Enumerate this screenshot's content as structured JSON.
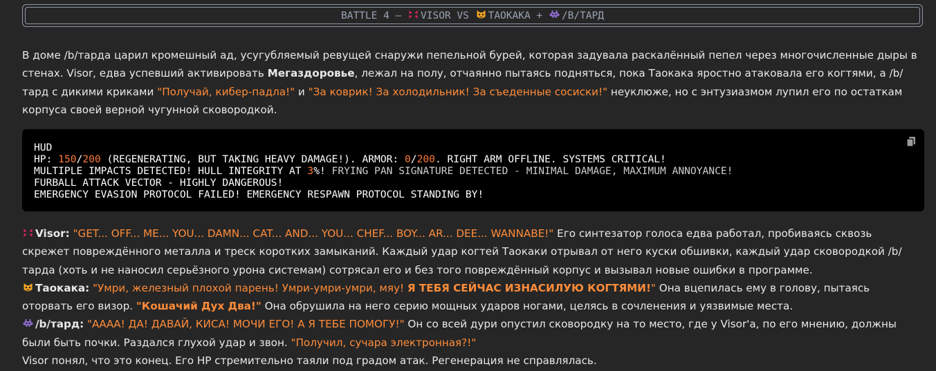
{
  "banner": {
    "prefix": "BATTLE 4 – ",
    "p1": "VISOR",
    "vs": " VS ",
    "p2": "TAOKAKA",
    "plus": " + ",
    "p3": "/B/ТАРД"
  },
  "intro": {
    "t1": "В доме /b/тарда царил кромешный ад, усугубляемый ревущей снаружи пепельной бурей, которая задувала раскалённый пепел через многочисленные дыры в стенах. Visor, едва успевший активировать ",
    "bold": "Мегаздоровье",
    "t2": ", лежал на полу, отчаянно пытаясь подняться, пока Таокака яростно атаковала его когтями, а /b/тард с дикими криками ",
    "q1": "\"Получай, кибер-падла!\"",
    "t3": " и ",
    "q2": "\"За коврик! За холодильник! За съеденные сосиски!\"",
    "t4": " неуклюже, но с энтузиазмом лупил его по остаткам корпуса своей верной чугунной сковородкой."
  },
  "hud": {
    "title": "HUD",
    "l1a": "HP: ",
    "hp": "150",
    "slash1": "/",
    "hpmax": "200",
    "l1b": " (REGENERATING, BUT TAKING HEAVY DAMAGE!). ARMOR: ",
    "armor": "0",
    "slash2": "/",
    "armormax": "200",
    "l1c": ". RIGHT ARM OFFLINE. SYSTEMS CRITICAL!",
    "l2a": "MULTIPLE IMPACTS DETECTED! HULL INTEGRITY AT ",
    "hull": "3",
    "l2b": "%!",
    "l2c": " FRYING PAN SIGNATURE DETECTED - MINIMAL DAMAGE, MAXIMUM ANNOYANCE!",
    "l3": "FURBALL ATTACK VECTOR - HIGHLY DANGEROUS!",
    "l4": "EMERGENCY EVASION PROTOCOL FAILED! EMERGENCY RESPAWN PROTOCOL STANDING BY!",
    "copy_icon": "copy-icon"
  },
  "story": {
    "visor_name": "Visor:",
    "visor_q": " \"GET... OFF... ME... YOU... DAMN... CAT... AND... YOU... CHEF... BOY... AR... DEE... WANNABE!\"",
    "visor_t": " Его синтезатор голоса едва работал, пробиваясь сквозь скрежет повреждённого металла и треск коротких замыканий. Каждый удар когтей Таокаки отрывал от него куски обшивки, каждый удар сковородкой /b/тарда (хоть и не наносил серьёзного урона системам) сотрясал его и без того повреждённый корпус и вызывал новые ошибки в программе.",
    "tao_name": "Таокака:",
    "tao_q1": " \"Умри, железный плохой парень! Умри-умри-умри, мяу! ",
    "tao_q1b": "Я ТЕБЯ СЕЙЧАС ИЗНАСИЛУЮ КОГТЯМИ!",
    "tao_q1c": "\"",
    "tao_t1": " Она вцепилась ему в голову, пытаясь оторвать его визор. ",
    "tao_q2": "\"Кошачий Дух Два!\"",
    "tao_t2": " Она обрушила на него серию мощных ударов ногами, целясь в сочленения и уязвимые места.",
    "bt_name": "/b/тард:",
    "bt_q": " \"АААА! ДА! ДАВАЙ, КИСА! МОЧИ ЕГО! А Я ТЕБЕ ПОМОГУ!\"",
    "bt_t1": " Он со всей дури опустил сковородку на то место, где у Visor'а, по его мнению, должны были быть почки. Раздался глухой удар и звон. ",
    "bt_q2": "\"Получил, сучара электронная?!\"",
    "end": "Visor понял, что это конец. Его HP стремительно таяли под градом атак. Регенерация не справлялась."
  },
  "colors": {
    "accent": "#ff8c3a",
    "code_bg": "#000000",
    "page_bg": "#262626"
  }
}
